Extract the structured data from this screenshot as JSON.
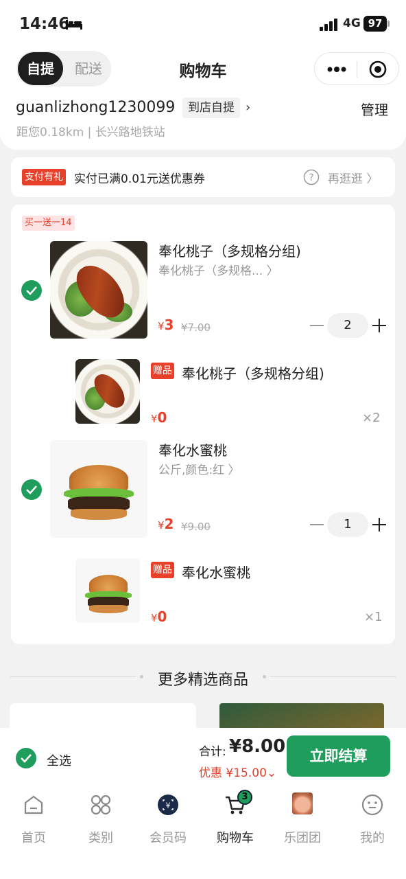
{
  "status_bar": {
    "time": "14:46",
    "network": "4G",
    "battery": "97"
  },
  "header": {
    "mode_pickup": "自提",
    "mode_delivery": "配送",
    "title": "购物车",
    "store_name": "guanlizhong1230099",
    "pickup_badge": "到店自提",
    "manage": "管理",
    "distance": "距您0.18km | 长兴路地铁站"
  },
  "promo": {
    "tag": "支付有礼",
    "text": "实付已满0.01元送优惠券",
    "more": "再逛逛 〉"
  },
  "cart": {
    "deal_tag": "买一送一14",
    "items": [
      {
        "name": "奉化桃子（多规格分组)",
        "spec": "奉化桃子（多规格... 〉",
        "price": "3",
        "original": "¥7.00",
        "qty": "2"
      },
      {
        "name": "奉化水蜜桃",
        "spec": "公斤,颜色:红 〉",
        "price": "2",
        "original": "¥9.00",
        "qty": "1"
      }
    ],
    "gifts": [
      {
        "tag": "赠品",
        "name": "奉化桃子（多规格分组)",
        "price": "0",
        "qty": "×2"
      },
      {
        "tag": "赠品",
        "name": "奉化水蜜桃",
        "price": "0",
        "qty": "×1"
      }
    ],
    "currency": "¥"
  },
  "more": {
    "title": "更多精选商品"
  },
  "checkout": {
    "select_all": "全选",
    "total_label": "合计:",
    "total_value": "¥8.00",
    "discount": "优惠 ¥15.00⌄",
    "button": "立即结算"
  },
  "tabs": [
    {
      "label": "首页",
      "icon": "home-icon"
    },
    {
      "label": "类别",
      "icon": "category-icon"
    },
    {
      "label": "会员码",
      "icon": "member-code-icon"
    },
    {
      "label": "购物车",
      "icon": "cart-icon",
      "badge": "3"
    },
    {
      "label": "乐团团",
      "icon": "group-avatar"
    },
    {
      "label": "我的",
      "icon": "profile-icon"
    }
  ],
  "colors": {
    "accent_green": "#1f9d5c",
    "price_red": "#e8402a"
  }
}
